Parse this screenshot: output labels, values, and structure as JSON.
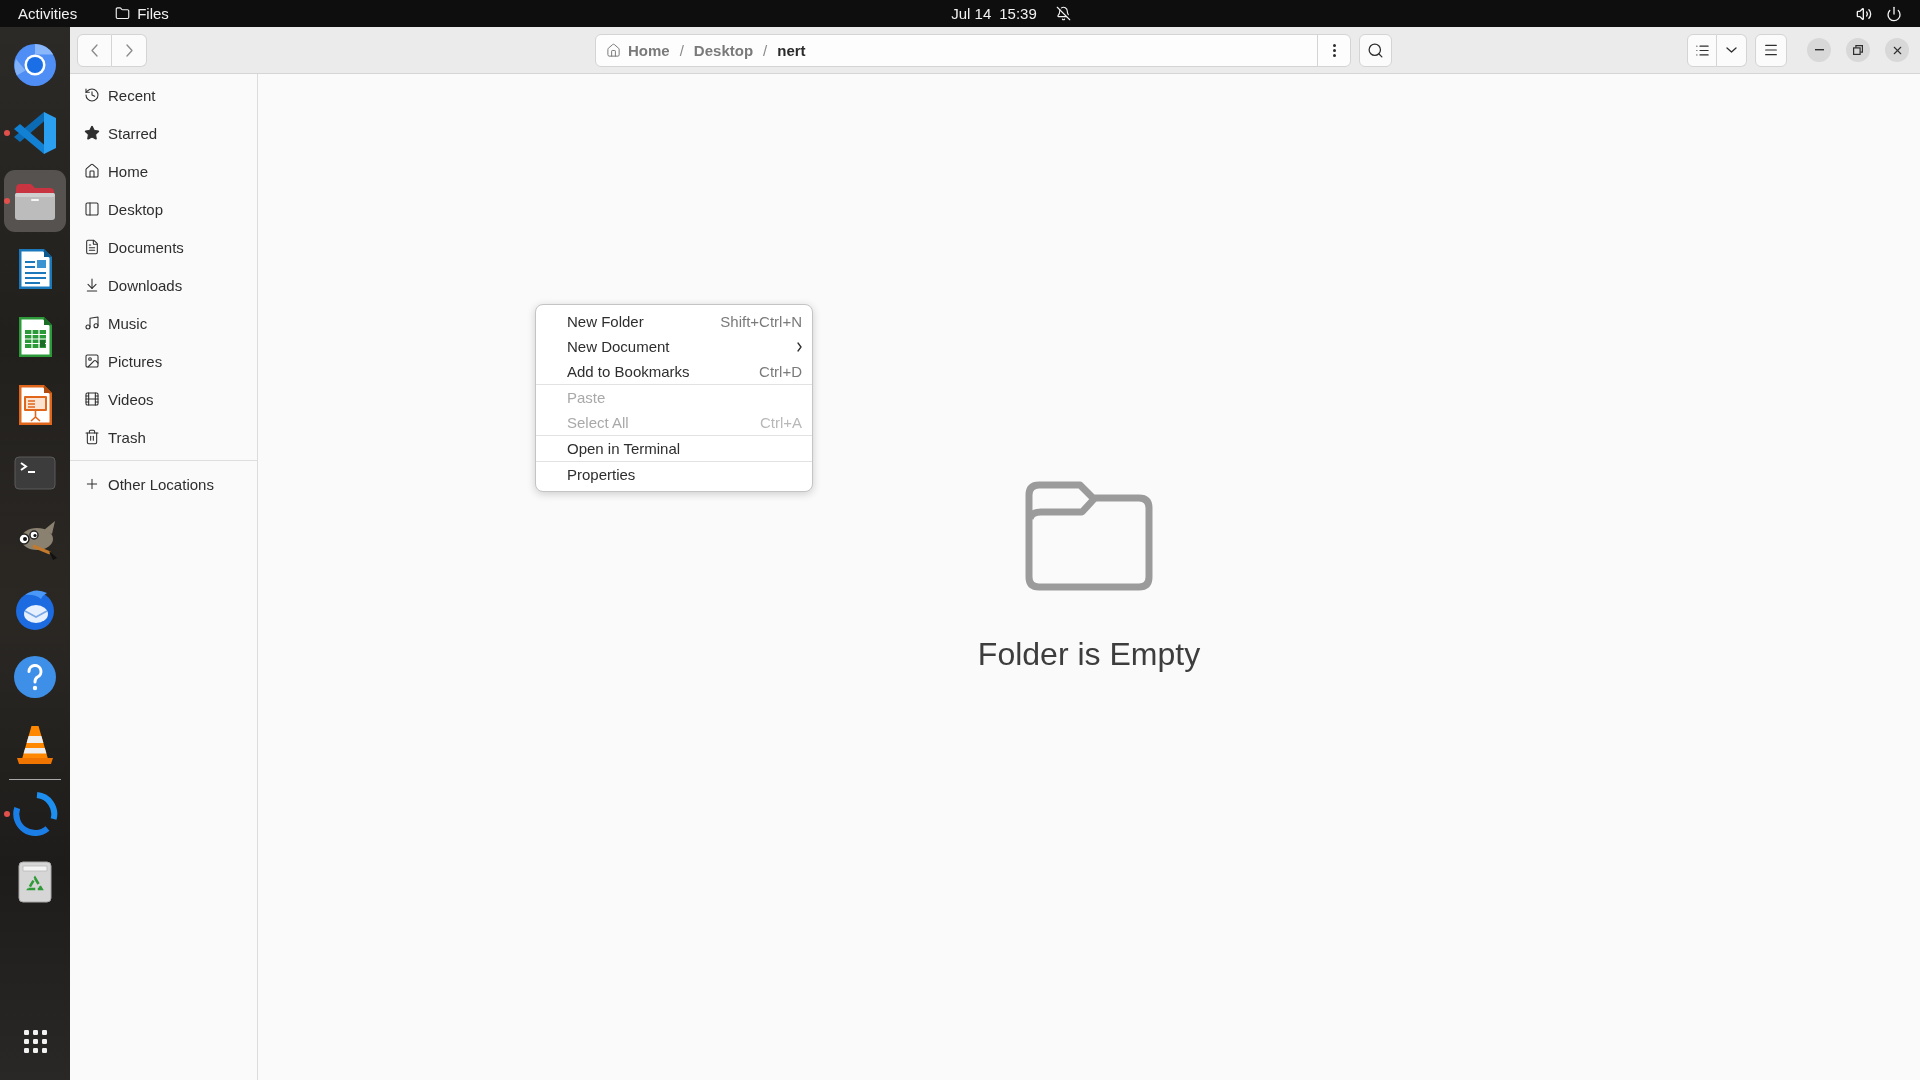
{
  "top_bar": {
    "activities": "Activities",
    "app_menu": "Files",
    "date": "Jul 14",
    "time": "15:39"
  },
  "dock": {
    "favorites": [
      {
        "kind": "browser",
        "running": false,
        "selected": false
      },
      {
        "kind": "code",
        "running": true,
        "selected": false
      },
      {
        "kind": "files",
        "running": true,
        "selected": true
      },
      {
        "kind": "writer",
        "running": false,
        "selected": false
      },
      {
        "kind": "calc",
        "running": false,
        "selected": false
      },
      {
        "kind": "impress",
        "running": false,
        "selected": false
      },
      {
        "kind": "terminal",
        "running": false,
        "selected": false
      },
      {
        "kind": "gimp",
        "running": false,
        "selected": false
      },
      {
        "kind": "mail",
        "running": false,
        "selected": false
      },
      {
        "kind": "help",
        "running": false,
        "selected": false
      },
      {
        "kind": "vlc",
        "running": false,
        "selected": false
      }
    ],
    "others": [
      {
        "kind": "sync",
        "running": true,
        "selected": false
      },
      {
        "kind": "trash",
        "running": false,
        "selected": false
      }
    ]
  },
  "toolbar": {
    "path": {
      "crumbs": [
        {
          "label": "Home",
          "kind": "home",
          "selected": false
        },
        {
          "label": "Desktop",
          "kind": "folder",
          "selected": false
        },
        {
          "label": "nert",
          "kind": "folder",
          "selected": true
        }
      ],
      "separators": [
        "/",
        "/"
      ]
    }
  },
  "sidebar": {
    "places": [
      {
        "label": "Recent",
        "kind": "recent",
        "selected": false
      },
      {
        "label": "Starred",
        "kind": "starred",
        "selected": false
      },
      {
        "label": "Home",
        "kind": "home",
        "selected": false
      },
      {
        "label": "Desktop",
        "kind": "desktop",
        "selected": false
      },
      {
        "label": "Documents",
        "kind": "documents",
        "selected": false
      },
      {
        "label": "Downloads",
        "kind": "downloads",
        "selected": false
      },
      {
        "label": "Music",
        "kind": "music",
        "selected": false
      },
      {
        "label": "Pictures",
        "kind": "pictures",
        "selected": false
      },
      {
        "label": "Videos",
        "kind": "videos",
        "selected": false
      },
      {
        "label": "Trash",
        "kind": "trash",
        "selected": false
      }
    ],
    "other_locations": {
      "label": "Other Locations"
    }
  },
  "empty_state": {
    "message": "Folder is Empty"
  },
  "context_menu": {
    "groups": [
      [
        {
          "label": "New Folder",
          "shortcut": "Shift+Ctrl+N",
          "submenu": false,
          "disabled": false
        },
        {
          "label": "New Document",
          "submenu": true,
          "disabled": false
        },
        {
          "label": "Add to Bookmarks",
          "shortcut": "Ctrl+D",
          "submenu": false,
          "disabled": false
        }
      ],
      [
        {
          "label": "Paste",
          "submenu": false,
          "disabled": true
        },
        {
          "label": "Select All",
          "shortcut": "Ctrl+A",
          "submenu": false,
          "disabled": true
        }
      ],
      [
        {
          "label": "Open in Terminal",
          "submenu": false,
          "disabled": false
        }
      ],
      [
        {
          "label": "Properties",
          "submenu": false,
          "disabled": false
        }
      ]
    ]
  }
}
